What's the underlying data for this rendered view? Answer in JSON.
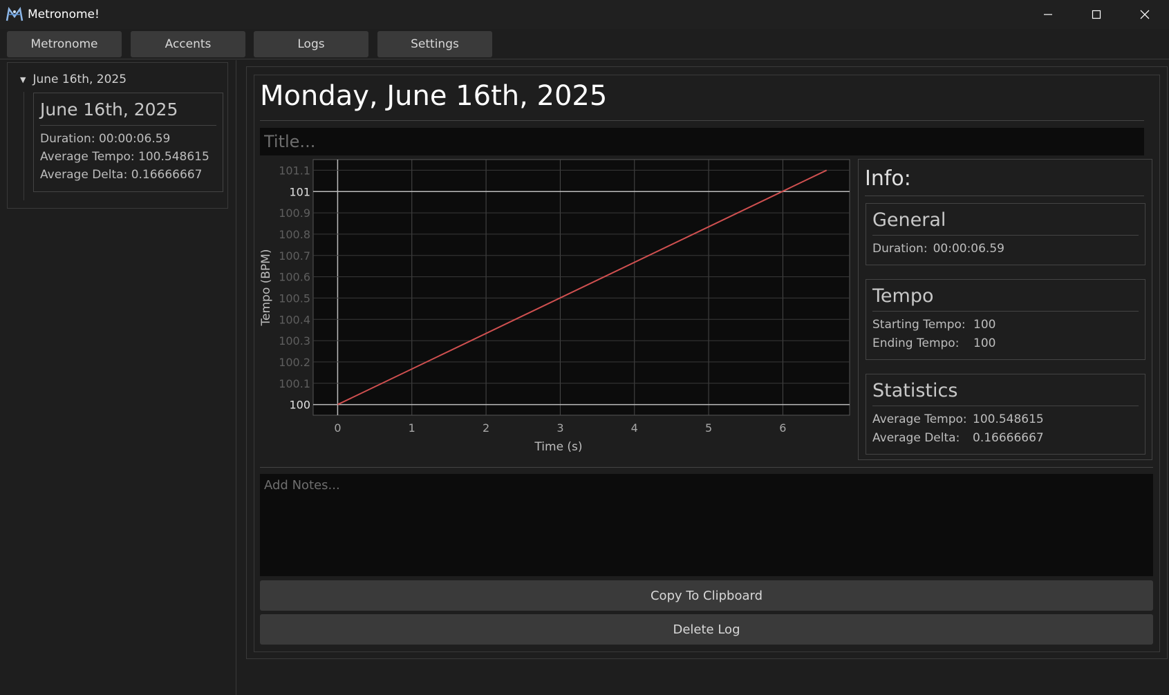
{
  "window": {
    "title": "Metronome!"
  },
  "tabs": [
    {
      "label": "Metronome"
    },
    {
      "label": "Accents"
    },
    {
      "label": "Logs"
    },
    {
      "label": "Settings"
    }
  ],
  "sidebar": {
    "tree_label": "June 16th, 2025",
    "card": {
      "title": "June 16th, 2025",
      "duration": "Duration: 00:00:06.59",
      "average_tempo": "Average Tempo: 100.548615",
      "average_delta": "Average Delta: 0.16666667"
    }
  },
  "main": {
    "heading": "Monday, June 16th, 2025",
    "title_placeholder": "Title...",
    "notes_placeholder": "Add Notes...",
    "copy_button": "Copy To Clipboard",
    "delete_button": "Delete Log"
  },
  "info": {
    "title": "Info:",
    "general": {
      "title": "General",
      "duration_label": "Duration:",
      "duration_value": "00:00:06.59"
    },
    "tempo": {
      "title": "Tempo",
      "starting_label": "Starting Tempo:",
      "starting_value": "100",
      "ending_label": "Ending Tempo:",
      "ending_value": "100"
    },
    "statistics": {
      "title": "Statistics",
      "avg_tempo_label": "Average Tempo:",
      "avg_tempo_value": "100.548615",
      "avg_delta_label": "Average Delta:",
      "avg_delta_value": "0.16666667"
    }
  },
  "chart_data": {
    "type": "line",
    "xlabel": "Time (s)",
    "ylabel": "Tempo (BPM)",
    "xlim": [
      -0.33,
      6.9
    ],
    "ylim": [
      99.95,
      101.15
    ],
    "x_ticks": [
      "0",
      "1",
      "2",
      "3",
      "4",
      "5",
      "6"
    ],
    "y_ticks": [
      "100",
      "100.1",
      "100.2",
      "100.3",
      "100.4",
      "100.5",
      "100.6",
      "100.7",
      "100.8",
      "100.9",
      "101",
      "101.1"
    ],
    "series": [
      {
        "x": [
          0,
          6.59
        ],
        "y": [
          100,
          101.1
        ],
        "color": "#d05050"
      }
    ],
    "highlight_y": [
      100,
      101
    ],
    "grid": true
  }
}
